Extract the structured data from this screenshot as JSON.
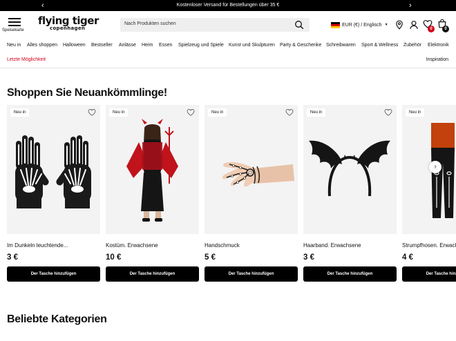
{
  "promo_bar": {
    "message": "Kostenloser Versand für Bestellungen über 35 €",
    "prev": "‹",
    "next": "›"
  },
  "header": {
    "menu_label": "Speisekarte",
    "logo_line1": "flying tiger",
    "logo_line2": "copenhagen",
    "search_placeholder": "Nach Produkten suchen",
    "locale": "EUR (€) / Englisch",
    "wishlist_count": "0",
    "cart_count": "0",
    "badge_color_wishlist": "#d0021b",
    "badge_color_cart": "#111111",
    "icons": [
      "menu-icon",
      "search-icon",
      "location-icon",
      "user-icon",
      "heart-icon",
      "bag-icon"
    ]
  },
  "nav": {
    "items": [
      "Neu in",
      "Alles shoppen",
      "Halloween",
      "Bestseller",
      "Anlässe",
      "Heim",
      "Essen",
      "Spielzeug und Spiele",
      "Kunst und Skulpturen",
      "Party & Geschenke",
      "Schreibwaren",
      "Sport & Wellness",
      "Zubehör",
      "Elektronik"
    ],
    "last_chance": "Letzte Möglichkeit",
    "inspiration": "Inspiration"
  },
  "new_arrivals": {
    "title": "Shoppen Sie Neuankömmlinge!",
    "products": [
      {
        "tag": "Neu in",
        "name": "Im Dunkeln leuchtende...",
        "price": "3 €",
        "button": "Der Tasche hinzufügen"
      },
      {
        "tag": "Neu in",
        "name": "Kostüm. Erwachsene",
        "price": "10 €",
        "button": "Der Tasche hinzufügen"
      },
      {
        "tag": "Neu in",
        "name": "Handschmuck",
        "price": "5 €",
        "button": "Der Tasche hinzufügen"
      },
      {
        "tag": "Neu in",
        "name": "Haarband. Erwachsene",
        "price": "3 €",
        "button": "Der Tasche hinzufügen"
      },
      {
        "tag": "Neu in",
        "name": "Strumpfhosen. Erwachsene",
        "price": "4 €",
        "button": "Der Tasche hinzufügen"
      }
    ],
    "next_arrow": "›"
  },
  "popular_categories": {
    "title": "Beliebte Kategorien"
  }
}
